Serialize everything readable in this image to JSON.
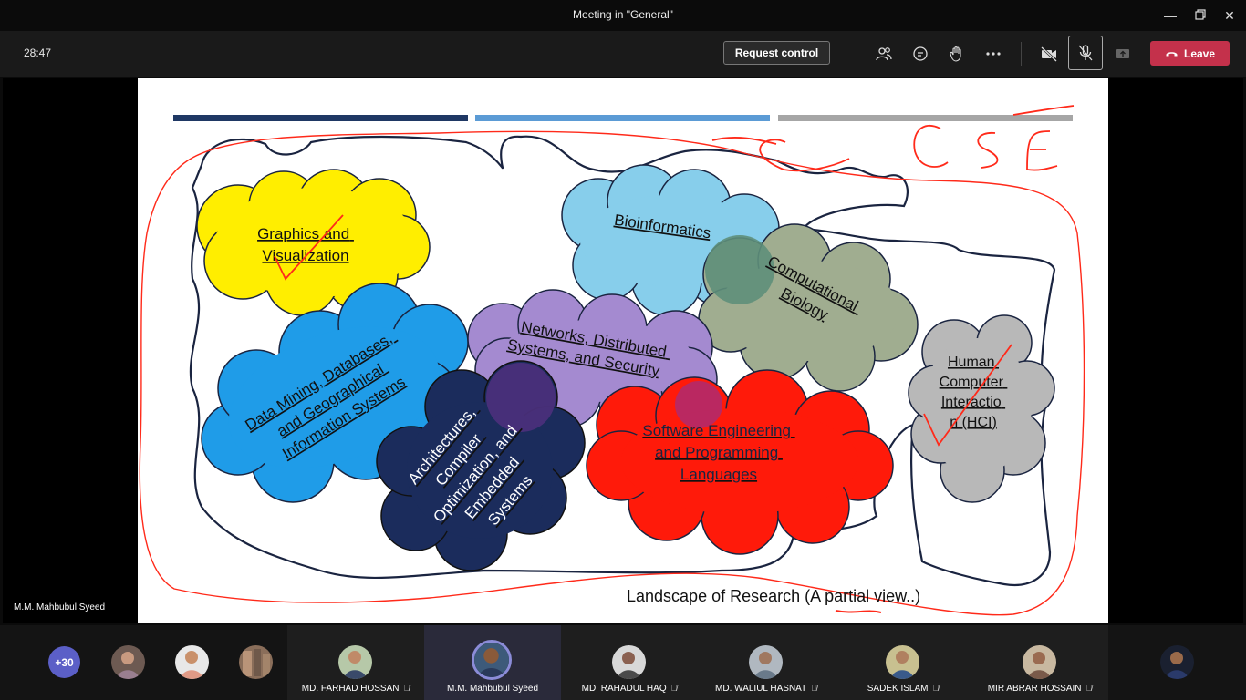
{
  "window": {
    "title": "Meeting in \"General\"",
    "controls": [
      "minimize",
      "restore",
      "close"
    ]
  },
  "toolbar": {
    "timer": "28:47",
    "request_control_label": "Request control",
    "icons": [
      "participants-icon",
      "chat-icon",
      "raise-hand-icon",
      "more-options-icon",
      "camera-off-icon",
      "mic-off-icon",
      "share-tray-icon"
    ],
    "leave_label": "Leave",
    "leave_color": "#c4314b"
  },
  "stage": {
    "presenter_name": "M.M. Mahbubul Syeed"
  },
  "slide": {
    "clouds": [
      {
        "id": "graphics",
        "lines": [
          "Graphics and",
          "Visualization"
        ],
        "color": "#ffee00"
      },
      {
        "id": "bioinformatics",
        "lines": [
          "Bioinformatics"
        ],
        "color": "#87ceeb"
      },
      {
        "id": "computational-biology",
        "lines": [
          "Computational",
          "Biology"
        ],
        "color": "#a0ad90"
      },
      {
        "id": "data-mining",
        "lines": [
          "Data Mining, Databases,",
          "and Geographical",
          "Information Systems"
        ],
        "color": "#1f9ce8"
      },
      {
        "id": "networks",
        "lines": [
          "Networks, Distributed",
          "Systems, and Security"
        ],
        "color": "#a48ad0"
      },
      {
        "id": "architectures",
        "lines": [
          "Architectures,",
          "Compiler",
          "Optimization, and",
          "Embedded",
          "Systems"
        ],
        "color": "#1b2c5c"
      },
      {
        "id": "software-engineering",
        "lines": [
          "Software Engineering",
          "and Programming",
          "Languages"
        ],
        "color": "#ff1a0a"
      },
      {
        "id": "hci",
        "lines": [
          "Human",
          "Computer",
          "Interactio",
          "n (HCI)"
        ],
        "color": "#b8b8b8"
      }
    ],
    "caption": "Landscape of Research (A partial view..)",
    "annotation": "CSE",
    "header_bar_colors": [
      "#1f3864",
      "#5b9bd5",
      "#a6a6a6"
    ]
  },
  "participants": {
    "overflow_count": "+30",
    "tiles": [
      {
        "name": "MD. FARHAD HOSSAN",
        "muted": true,
        "active": false
      },
      {
        "name": "M.M. Mahbubul Syeed",
        "muted": false,
        "active": true
      },
      {
        "name": "MD. RAHADUL HAQ",
        "muted": true,
        "active": false
      },
      {
        "name": "MD. WALIUL HASNAT",
        "muted": true,
        "active": false
      },
      {
        "name": "SADEK ISLAM",
        "muted": true,
        "active": false
      },
      {
        "name": "MIR ABRAR HOSSAIN",
        "muted": true,
        "active": false
      }
    ]
  }
}
